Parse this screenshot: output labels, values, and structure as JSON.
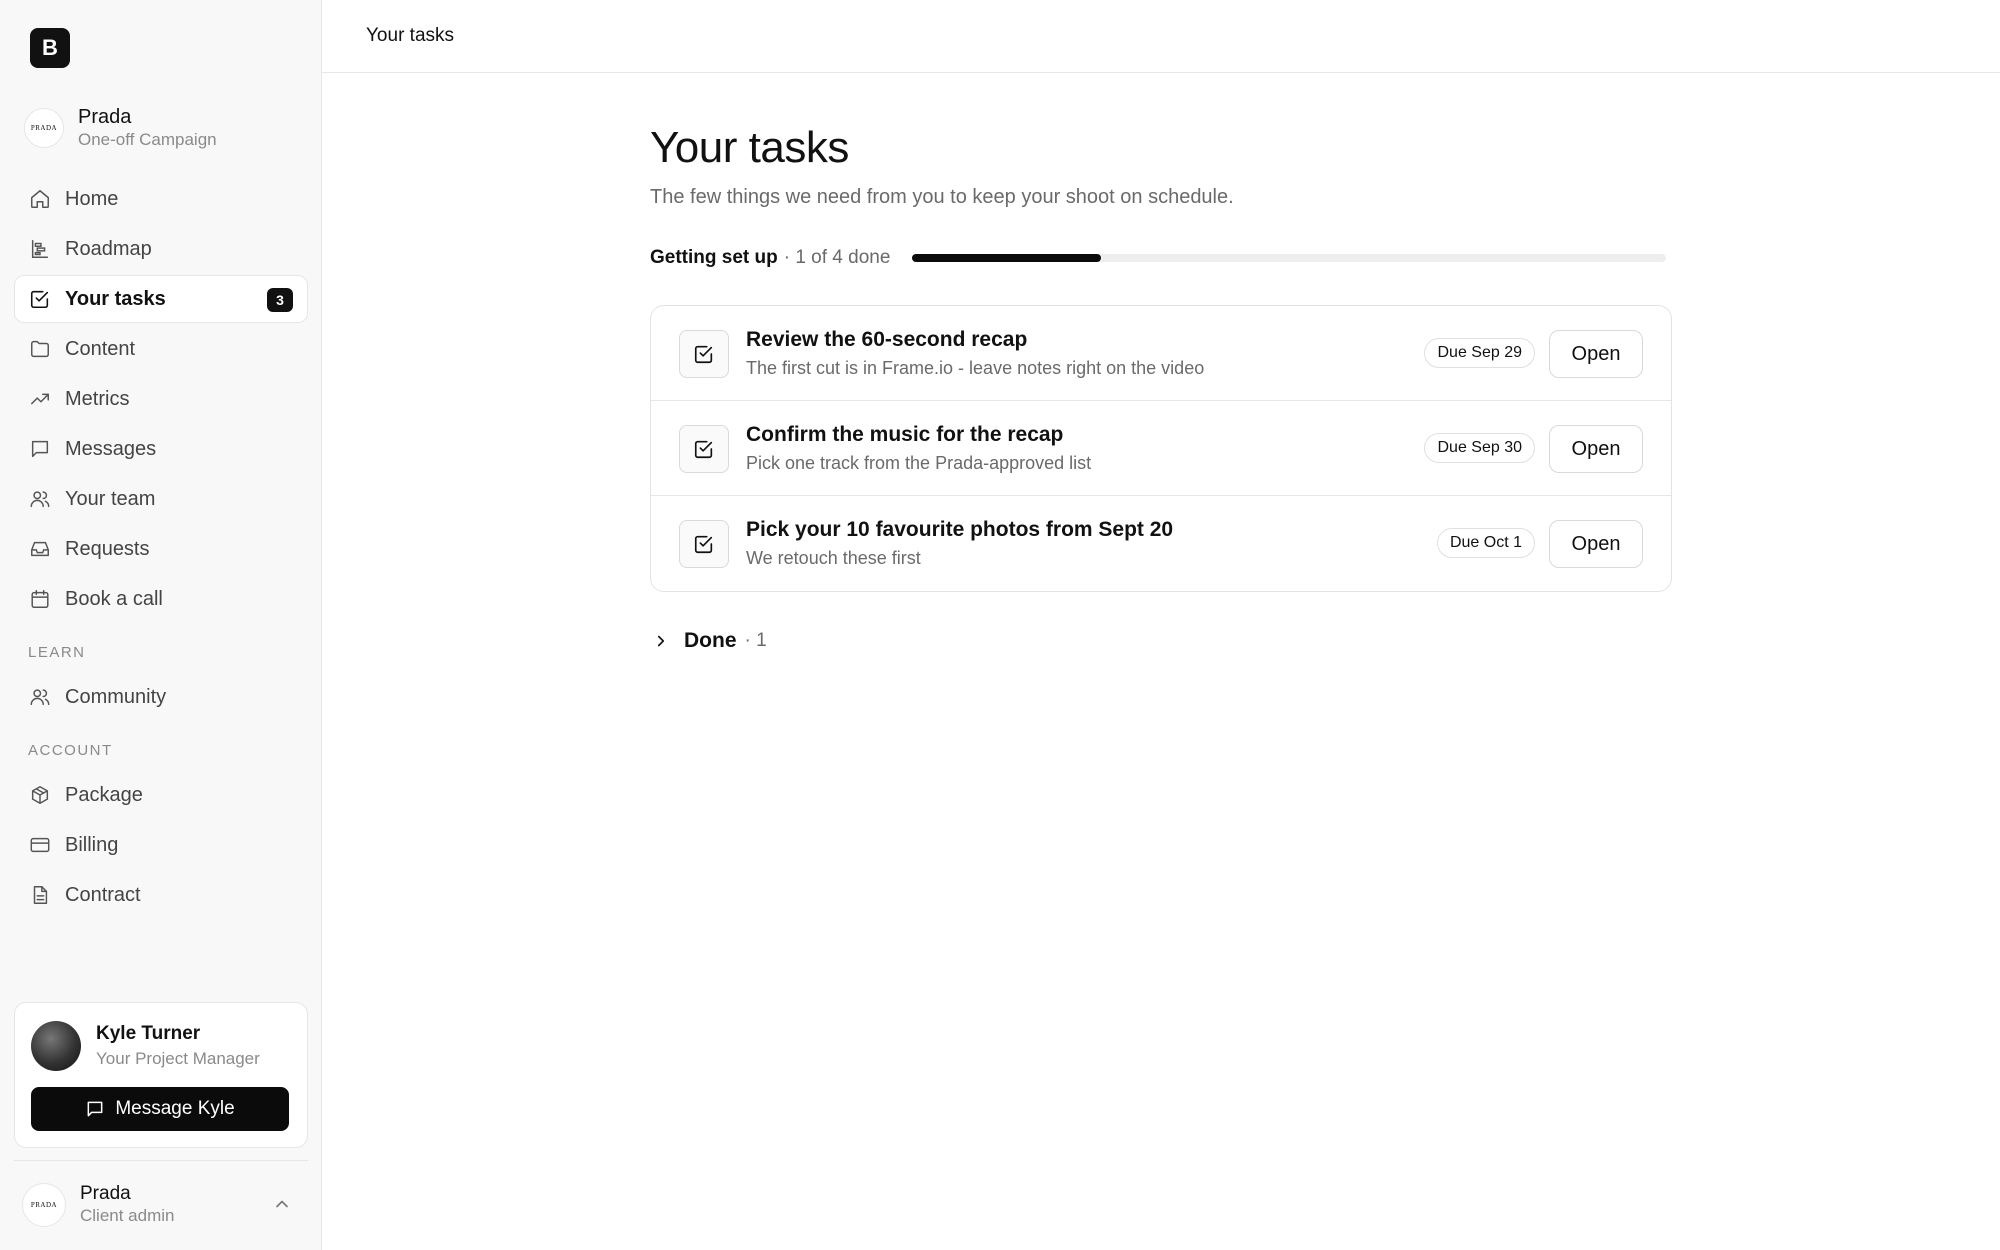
{
  "app": {
    "logo_letter": "B"
  },
  "client": {
    "logo_text": "PRADA",
    "name": "Prada",
    "subtitle": "One-off Campaign"
  },
  "nav": {
    "items": [
      {
        "label": "Home",
        "icon": "home-icon"
      },
      {
        "label": "Roadmap",
        "icon": "roadmap-icon"
      },
      {
        "label": "Your tasks",
        "icon": "checkbox-icon",
        "active": true,
        "badge": "3"
      },
      {
        "label": "Content",
        "icon": "folder-icon"
      },
      {
        "label": "Metrics",
        "icon": "trend-icon"
      },
      {
        "label": "Messages",
        "icon": "message-icon"
      },
      {
        "label": "Your team",
        "icon": "users-icon"
      },
      {
        "label": "Requests",
        "icon": "inbox-icon"
      },
      {
        "label": "Book a call",
        "icon": "calendar-icon"
      }
    ],
    "learn_label": "LEARN",
    "learn_items": [
      {
        "label": "Community",
        "icon": "users-icon"
      }
    ],
    "account_label": "ACCOUNT",
    "account_items": [
      {
        "label": "Package",
        "icon": "package-icon"
      },
      {
        "label": "Billing",
        "icon": "credit-card-icon"
      },
      {
        "label": "Contract",
        "icon": "document-icon"
      }
    ]
  },
  "project_manager": {
    "name": "Kyle Turner",
    "role": "Your Project Manager",
    "button_label": "Message Kyle"
  },
  "account": {
    "logo_text": "PRADA",
    "name": "Prada",
    "role": "Client admin"
  },
  "topbar": {
    "title": "Your tasks"
  },
  "main": {
    "title": "Your tasks",
    "subtitle": "The few things we need from you to keep your shoot on schedule.",
    "progress": {
      "label": "Getting set up",
      "count_text": "· 1 of 4 done",
      "done": 1,
      "total": 4
    },
    "tasks": [
      {
        "title": "Review the 60-second recap",
        "description": "The first cut is in Frame.io - leave notes right on the video",
        "due": "Due Sep 29",
        "action": "Open"
      },
      {
        "title": "Confirm the music for the recap",
        "description": "Pick one track from the Prada-approved list",
        "due": "Due Sep 30",
        "action": "Open"
      },
      {
        "title": "Pick your 10 favourite photos from Sept 20",
        "description": "We retouch these first",
        "due": "Due Oct 1",
        "action": "Open"
      }
    ],
    "done_section": {
      "label": "Done",
      "count_text": "· 1"
    }
  },
  "colors": {
    "accent": "#0b0b0b",
    "sidebar_bg": "#f8f8f8",
    "muted_text": "#8a8a8a",
    "border": "#e6e6e6"
  }
}
